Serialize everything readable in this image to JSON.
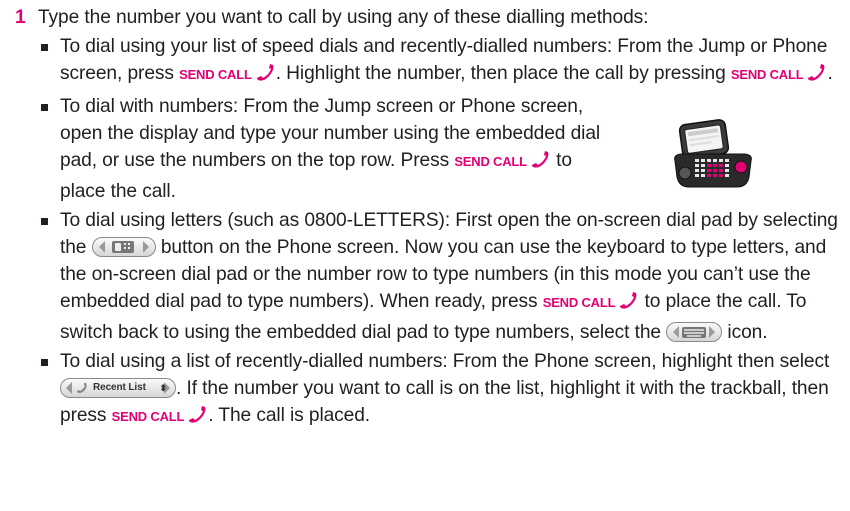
{
  "step": {
    "number": "1",
    "intro": "Type the number you want to call by using any of these dialling methods:"
  },
  "send_call_label": "SEND CALL",
  "bullets": {
    "speed": {
      "a": "To dial using your list of speed dials and recently-dialled numbers: From the Jump or Phone screen, press ",
      "b": ". Highlight the number, then place the call by pressing ",
      "c": "."
    },
    "numbers": {
      "a": "To dial with numbers: From the Jump screen or Phone screen, open the display and type your number using the embedded dial pad, or use the numbers on the top row. Press ",
      "b": " to place the call."
    },
    "letters": {
      "a": "To dial using letters (such as 0800-LETTERS): First open the on-screen dial pad by selecting the ",
      "b": " button on the Phone screen. Now you can use the keyboard to type letters, and the on-screen dial pad or the number row to type numbers (in this mode you can’t use the embedded dial pad to type numbers). When ready, press ",
      "c": " to place the call. To switch back to using the embedded dial pad to type numbers, select the ",
      "d": " icon."
    },
    "recent": {
      "a": "To dial using a list of recently-dialled numbers: From the Phone screen, highlight then select ",
      "b": ". If the number you want to call is on the list, highlight it with the trackball, then press ",
      "c": ". The call is placed."
    }
  },
  "recent_list_button": {
    "label": "Recent List",
    "arrows": "⬍"
  },
  "colors": {
    "accent": "#e20074",
    "text": "#231f20"
  },
  "icons": [
    "handset-icon",
    "dial-pad-button-icon",
    "keyboard-button-icon",
    "device-illustration"
  ]
}
